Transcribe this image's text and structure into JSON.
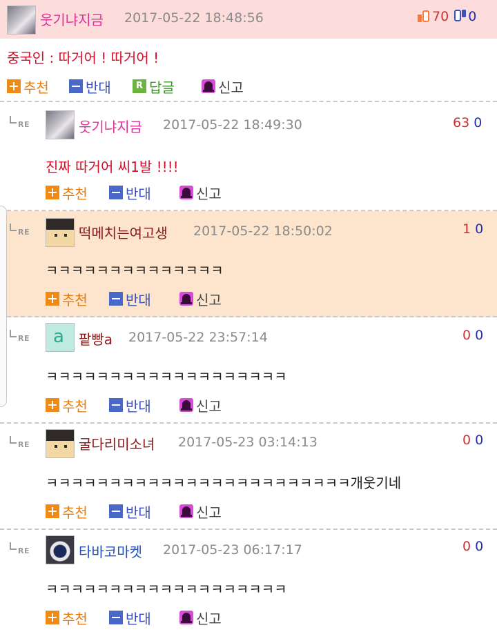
{
  "top_comment": {
    "nickname": "웃기냐지금",
    "date": "2017-05-22 18:48:56",
    "up_count": "70",
    "down_count": "0",
    "content": "중국인 : 따거어 ! 따거어 !",
    "actions": {
      "recommend": "추천",
      "oppose": "반대",
      "reply": "답글",
      "reply_icon_letter": "R",
      "report": "신고"
    }
  },
  "re_label": "RE",
  "replies": [
    {
      "nickname": "웃기냐지금",
      "date": "2017-05-22 18:49:30",
      "up": "63",
      "down": "0",
      "content": "진짜 따거어 씨1발 !!!!",
      "nick_color": "#e0309a",
      "content_color": "#d0102a",
      "highlight": false
    },
    {
      "nickname": "떡메치는여고생",
      "date": "2017-05-22 18:50:02",
      "up": "1",
      "down": "0",
      "content": "ㅋㅋㅋㅋㅋㅋㅋㅋㅋㅋㅋㅋㅋㅋ",
      "nick_color": "#8a1818",
      "content_color": "#222222",
      "highlight": true
    },
    {
      "nickname": "팥빵a",
      "date": "2017-05-22 23:57:14",
      "up": "0",
      "down": "0",
      "content": "ㅋㅋㅋㅋㅋㅋㅋㅋㅋㅋㅋㅋㅋㅋㅋㅋㅋㅋㅋ",
      "nick_color": "#8a1818",
      "content_color": "#222222",
      "highlight": false
    },
    {
      "nickname": "굴다리미소녀",
      "date": "2017-05-23 03:14:13",
      "up": "0",
      "down": "0",
      "content": "ㅋㅋㅋㅋㅋㅋㅋㅋㅋㅋㅋㅋㅋㅋㅋㅋㅋㅋㅋㅋㅋㅋㅋㅋ개웃기네",
      "nick_color": "#8a1818",
      "content_color": "#222222",
      "highlight": false
    },
    {
      "nickname": "타바코마켓",
      "date": "2017-05-23 06:17:17",
      "up": "0",
      "down": "0",
      "content": "ㅋㅋㅋㅋㅋㅋㅋㅋㅋㅋㅋㅋㅋㅋㅋㅋㅋㅋㅋ",
      "nick_color": "#2050c0",
      "content_color": "#222222",
      "highlight": false
    }
  ],
  "reply_actions": {
    "recommend": "추천",
    "oppose": "반대",
    "report": "신고"
  },
  "colors": {
    "top_bg": "#fddcdc",
    "highlight_bg": "#fde4cc",
    "up": "#d03030",
    "down": "#2030b0"
  }
}
